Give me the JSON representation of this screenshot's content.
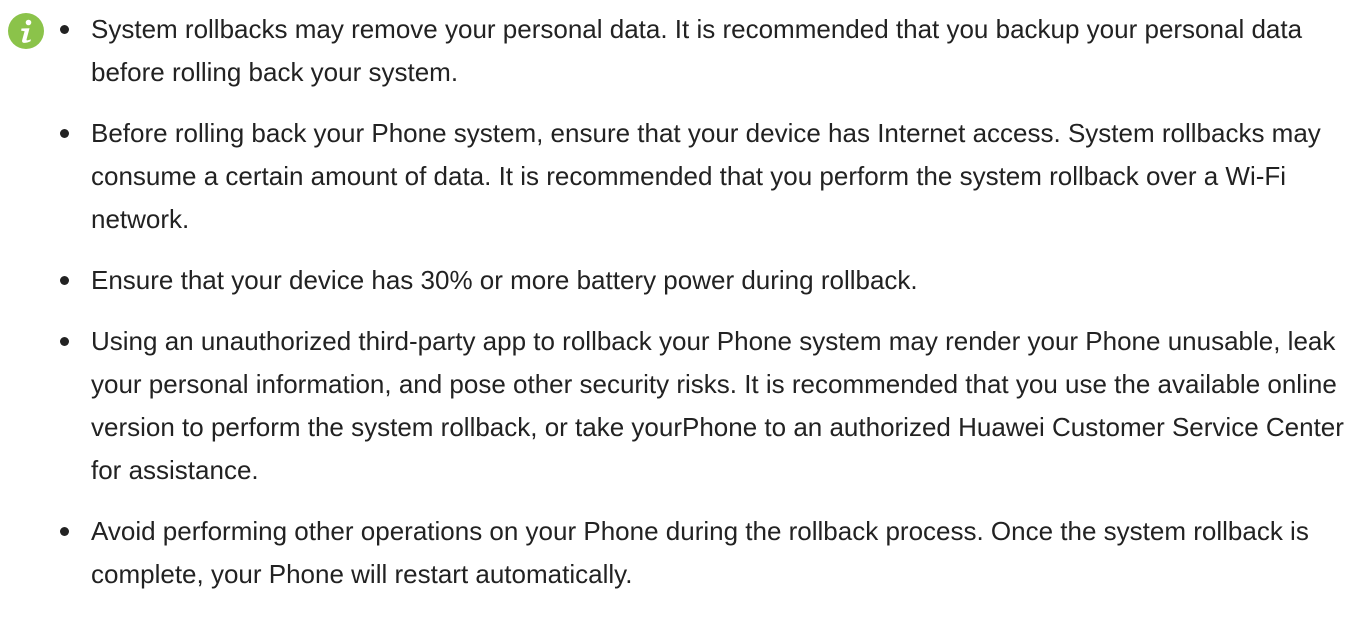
{
  "note": {
    "icon": "info-icon",
    "icon_color": "#8bc34a",
    "items": [
      {
        "text": "System rollbacks may remove your personal data. It is recommended that you backup your personal data before rolling back your system."
      },
      {
        "text": "Before rolling back your Phone system, ensure that your device has Internet access. System rollbacks may consume a certain amount of data. It is recommended that you perform the system rollback over a Wi-Fi network."
      },
      {
        "text": "Ensure that your device has 30% or more battery power during rollback."
      },
      {
        "text": "Using an unauthorized third-party app to rollback your Phone system may render your Phone unusable, leak your personal information, and pose other security risks. It is recommended that you use the available online version to perform the system rollback, or take yourPhone to an authorized Huawei Customer Service Center for assistance."
      },
      {
        "text": "Avoid performing other operations on your Phone during the rollback process. Once the system rollback is complete, your Phone will restart automatically."
      }
    ]
  }
}
